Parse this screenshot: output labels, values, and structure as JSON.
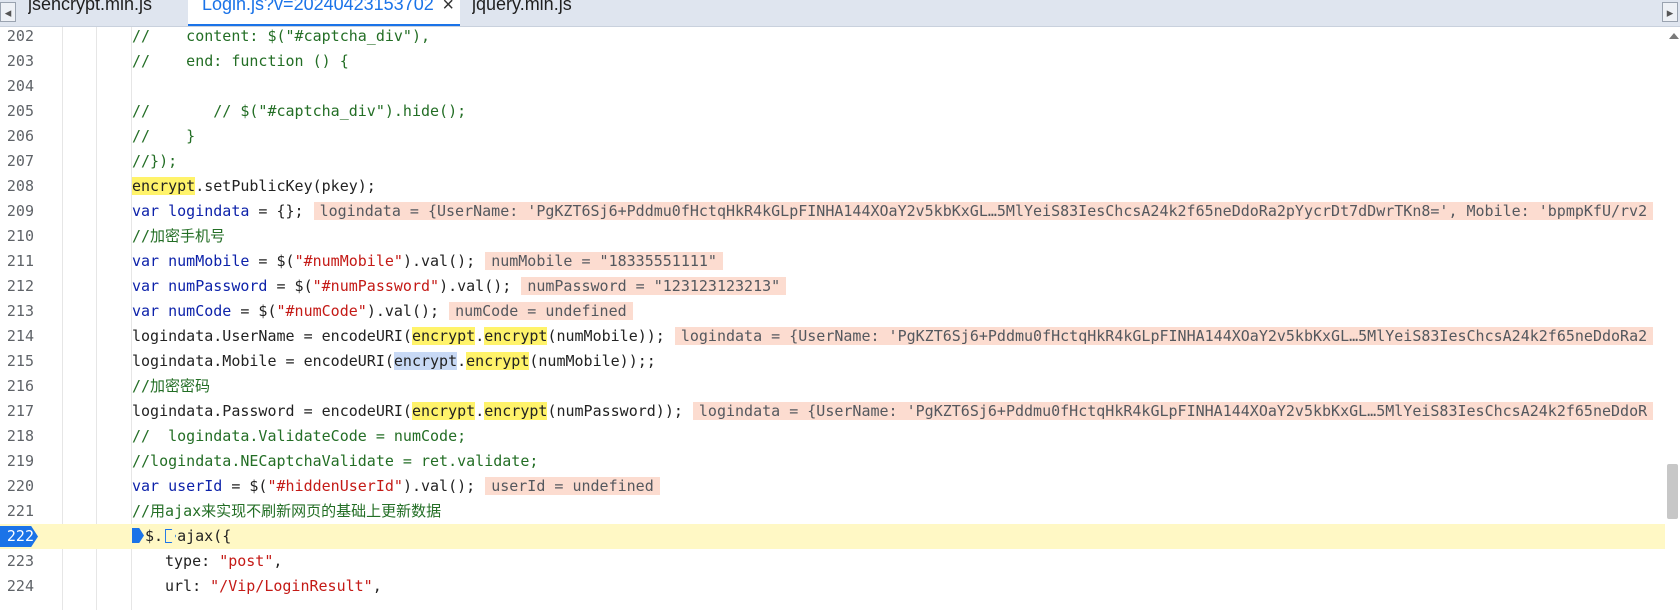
{
  "tabs": [
    {
      "label": "jsencrypt.min.js",
      "active": false
    },
    {
      "label": "Login.js?v=20240423153702",
      "active": true,
      "close": "×"
    },
    {
      "label": "jquery.min.js",
      "active": false
    }
  ],
  "tab_nav": {
    "left": "◂",
    "right": "▸"
  },
  "debugger": {
    "current_line": "222"
  },
  "lines": [
    {
      "n": "202",
      "indent": 1,
      "parts": [
        [
          "cm",
          "//    content: $(\"#captcha_div\"),"
        ]
      ]
    },
    {
      "n": "203",
      "indent": 1,
      "parts": [
        [
          "cm",
          "//    end: function () {"
        ]
      ]
    },
    {
      "n": "204",
      "indent": 1,
      "parts": []
    },
    {
      "n": "205",
      "indent": 1,
      "parts": [
        [
          "cm",
          "//       // $(\"#captcha_div\").hide();"
        ]
      ]
    },
    {
      "n": "206",
      "indent": 1,
      "parts": [
        [
          "cm",
          "//    }"
        ]
      ]
    },
    {
      "n": "207",
      "indent": 1,
      "parts": [
        [
          "cm",
          "//});"
        ]
      ]
    },
    {
      "n": "208",
      "indent": 1,
      "parts": [
        [
          "hl",
          "encrypt"
        ],
        [
          "pl",
          ".setPublicKey(pkey);"
        ]
      ]
    },
    {
      "n": "209",
      "indent": 1,
      "parts": [
        [
          "kw",
          "var logindata"
        ],
        [
          "pl",
          " = {};"
        ],
        [
          "val",
          "logindata = {UserName: 'PgKZT6Sj6+Pddmu0fHctqHkR4kGLpFINHA144XOaY2v5kbKxGL…5MlYeiS83IesChcsA24k2f65neDdoRa2pYycrDt7dDwrTKn8=', Mobile: 'bpmpKfU/rv2"
        ]
      ]
    },
    {
      "n": "210",
      "indent": 1,
      "parts": [
        [
          "cm",
          "//加密手机号"
        ]
      ]
    },
    {
      "n": "211",
      "indent": 1,
      "parts": [
        [
          "kw",
          "var numMobile"
        ],
        [
          "pl",
          " = $("
        ],
        [
          "str",
          "\"#numMobile\""
        ],
        [
          "pl",
          ").val();"
        ],
        [
          "val",
          "numMobile = \"18335551111\""
        ]
      ]
    },
    {
      "n": "212",
      "indent": 1,
      "parts": [
        [
          "kw",
          "var numPassword"
        ],
        [
          "pl",
          " = $("
        ],
        [
          "str",
          "\"#numPassword\""
        ],
        [
          "pl",
          ").val();"
        ],
        [
          "val",
          "numPassword = \"123123123213\""
        ]
      ]
    },
    {
      "n": "213",
      "indent": 1,
      "parts": [
        [
          "kw",
          "var numCode"
        ],
        [
          "pl",
          " = $("
        ],
        [
          "str",
          "\"#numCode\""
        ],
        [
          "pl",
          ").val();"
        ],
        [
          "val",
          "numCode = undefined"
        ]
      ]
    },
    {
      "n": "214",
      "indent": 1,
      "parts": [
        [
          "pl",
          "logindata.UserName = encodeURI("
        ],
        [
          "hl",
          "encrypt"
        ],
        [
          "pl",
          "."
        ],
        [
          "hl",
          "encrypt"
        ],
        [
          "pl",
          "(numMobile));"
        ],
        [
          "val",
          "logindata = {UserName: 'PgKZT6Sj6+Pddmu0fHctqHkR4kGLpFINHA144XOaY2v5kbKxGL…5MlYeiS83IesChcsA24k2f65neDdoRa2"
        ]
      ]
    },
    {
      "n": "215",
      "indent": 1,
      "parts": [
        [
          "pl",
          "logindata.Mobile = encodeURI("
        ],
        [
          "sel",
          "encrypt"
        ],
        [
          "pl",
          "."
        ],
        [
          "hl",
          "encrypt"
        ],
        [
          "pl",
          "(numMobile));;"
        ]
      ]
    },
    {
      "n": "216",
      "indent": 1,
      "parts": [
        [
          "cm",
          "//加密密码"
        ]
      ]
    },
    {
      "n": "217",
      "indent": 1,
      "parts": [
        [
          "pl",
          "logindata.Password = encodeURI("
        ],
        [
          "hl",
          "encrypt"
        ],
        [
          "pl",
          "."
        ],
        [
          "hl",
          "encrypt"
        ],
        [
          "pl",
          "(numPassword));"
        ],
        [
          "val",
          "logindata = {UserName: 'PgKZT6Sj6+Pddmu0fHctqHkR4kGLpFINHA144XOaY2v5kbKxGL…5MlYeiS83IesChcsA24k2f65neDdoR"
        ]
      ]
    },
    {
      "n": "218",
      "indent": 1,
      "parts": [
        [
          "cm",
          "//  logindata.ValidateCode = numCode;"
        ]
      ]
    },
    {
      "n": "219",
      "indent": 1,
      "parts": [
        [
          "cm",
          "//logindata.NECaptchaValidate = ret.validate;"
        ]
      ]
    },
    {
      "n": "220",
      "indent": 1,
      "parts": [
        [
          "kw",
          "var userId"
        ],
        [
          "pl",
          " = $("
        ],
        [
          "str",
          "\"#hiddenUserId\""
        ],
        [
          "pl",
          ").val();"
        ],
        [
          "val",
          "userId = undefined"
        ]
      ]
    },
    {
      "n": "221",
      "indent": 1,
      "parts": [
        [
          "cm",
          "//用ajax来实现不刷新网页的基础上更新数据"
        ]
      ]
    },
    {
      "n": "222",
      "indent": 1,
      "current": true,
      "parts": [
        [
          "arrow",
          ""
        ],
        [
          "pl",
          "$."
        ],
        [
          "arrow2",
          ""
        ],
        [
          "pl",
          "ajax({"
        ]
      ]
    },
    {
      "n": "223",
      "indent": 2,
      "parts": [
        [
          "pl",
          "type: "
        ],
        [
          "str",
          "\"post\""
        ],
        [
          "pl",
          ","
        ]
      ]
    },
    {
      "n": "224",
      "indent": 2,
      "parts": [
        [
          "pl",
          "url: "
        ],
        [
          "str",
          "\"/Vip/LoginResult\""
        ],
        [
          "pl",
          ","
        ]
      ]
    }
  ]
}
